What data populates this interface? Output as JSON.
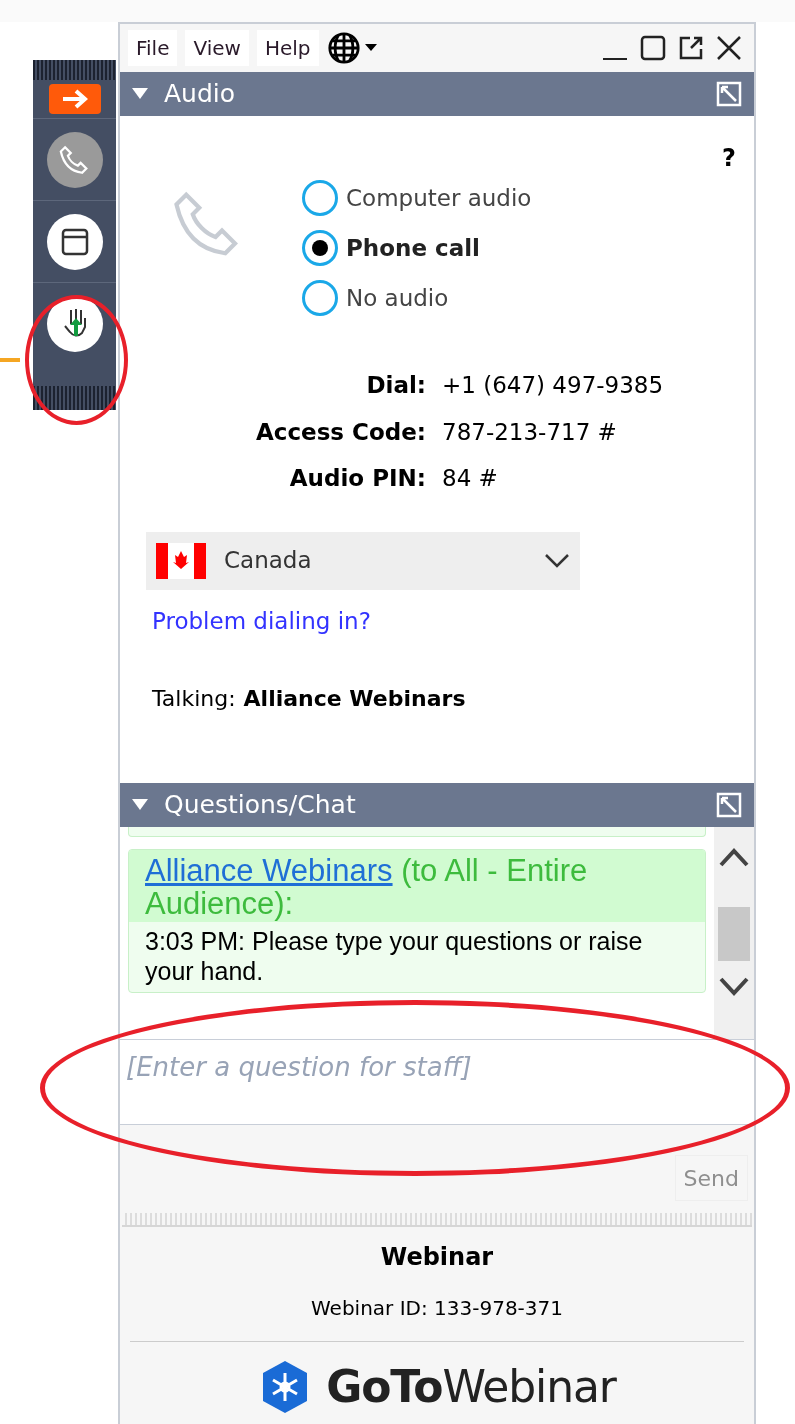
{
  "menu": [
    "File",
    "View",
    "Help"
  ],
  "audio": {
    "title": "Audio",
    "help": "?",
    "options": [
      {
        "label": "Computer audio",
        "selected": false
      },
      {
        "label": "Phone call",
        "selected": true
      },
      {
        "label": "No audio",
        "selected": false
      }
    ],
    "details": [
      {
        "label": "Dial:",
        "value": "+1 (647) 497-9385"
      },
      {
        "label": "Access Code:",
        "value": "787-213-717 #"
      },
      {
        "label": "Audio PIN:",
        "value": "84 #"
      }
    ],
    "country": "Canada",
    "problem_link": "Problem dialing in?",
    "talking": {
      "label": "Talking:",
      "value": "Alliance Webinars"
    }
  },
  "chat": {
    "title": "Questions/Chat",
    "message": {
      "sender": "Alliance Webinars",
      "audience": "(to All - Entire Audience):",
      "body": "3:03 PM: Please type your questions or raise your hand."
    },
    "placeholder": "[Enter a question for staff]",
    "send": "Send"
  },
  "footer": {
    "title": "Webinar",
    "id": "Webinar ID: 133-978-371",
    "logo": "**GoTo**Webinar"
  }
}
